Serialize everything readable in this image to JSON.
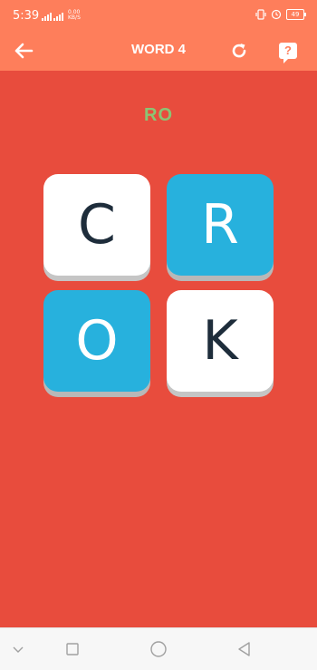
{
  "status_bar": {
    "time": "5:39",
    "network_speed_top": "0.00",
    "network_speed_bottom": "KB/S",
    "battery": "49"
  },
  "toolbar": {
    "title": "WORD 4",
    "back_icon": "arrow-left-icon",
    "reset_icon": "refresh-icon",
    "hint_icon": "question-bubble-icon",
    "hint_symbol": "?"
  },
  "game": {
    "current_word": "RO",
    "tiles": [
      {
        "letter": "C",
        "state": "unselected"
      },
      {
        "letter": "R",
        "state": "selected"
      },
      {
        "letter": "O",
        "state": "selected"
      },
      {
        "letter": "K",
        "state": "unselected"
      }
    ]
  },
  "nav_bar": {
    "icons": [
      "chevron-down-icon",
      "recents-square-icon",
      "home-circle-icon",
      "back-triangle-icon"
    ]
  },
  "colors": {
    "background": "#e84c3d",
    "toolbar": "#fe7e5b",
    "tile_selected": "#27b1dd",
    "tile_unselected": "#ffffff",
    "word_text": "#8bc474",
    "tile_letter_dark": "#1e2d3b"
  }
}
